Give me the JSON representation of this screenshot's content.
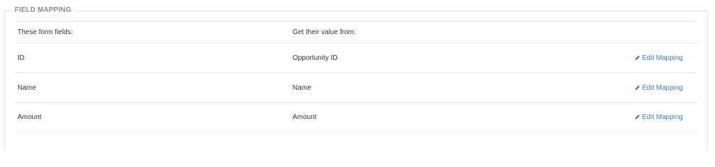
{
  "section": {
    "title": "FIELD MAPPING"
  },
  "table": {
    "headers": {
      "form_fields": "These form fields:",
      "value_source": "Get their value from:"
    },
    "rows": [
      {
        "field": "ID",
        "source": "Opportunity ID",
        "action": "Edit Mapping"
      },
      {
        "field": "Name",
        "source": "Name",
        "action": "Edit Mapping"
      },
      {
        "field": "Amount",
        "source": "Amount",
        "action": "Edit Mapping"
      }
    ]
  },
  "icons": {
    "edit": "pencil-icon"
  },
  "colors": {
    "link": "#3b7ec7",
    "legend": "#8a8a8a",
    "border": "#e5e5e5"
  }
}
